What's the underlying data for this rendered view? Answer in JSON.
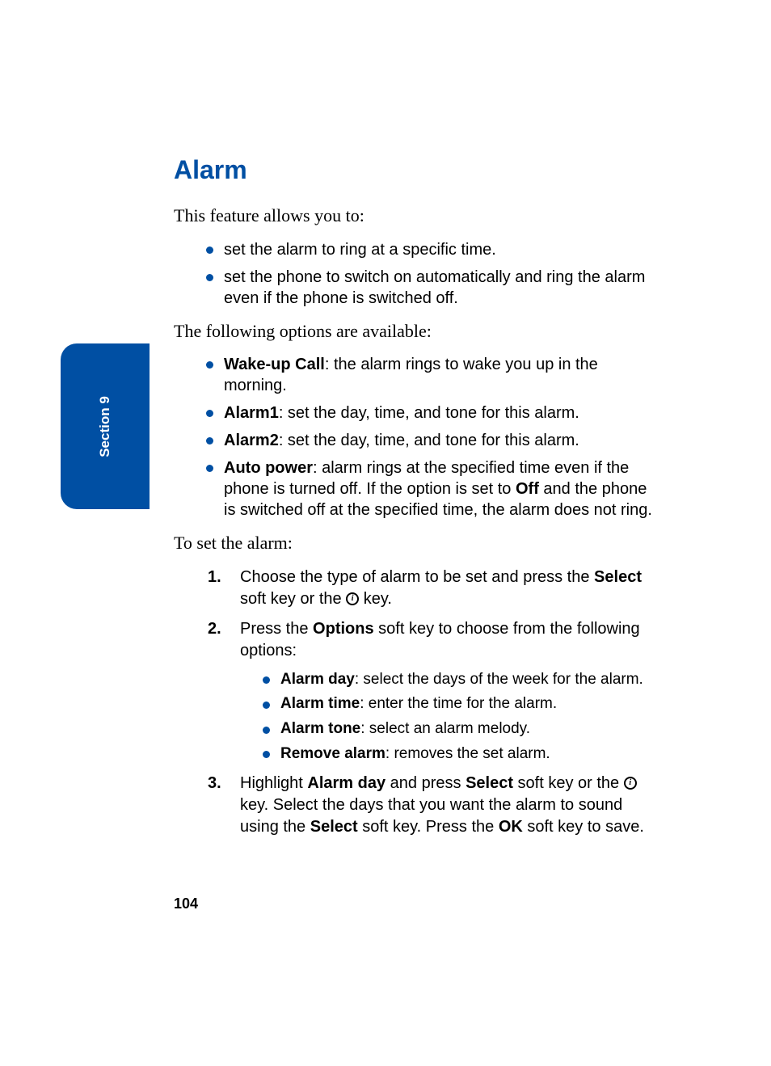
{
  "colors": {
    "accent": "#004fa3"
  },
  "side_tab": {
    "label": "Section 9"
  },
  "title": "Alarm",
  "intro": "This feature allows you to:",
  "intro_bullets": [
    "set the alarm to ring at a specific time.",
    "set the phone to switch on automatically and ring the alarm even if the phone is switched off."
  ],
  "options_lead": "The following options are available:",
  "options": [
    {
      "term": "Wake-up Call",
      "desc": ": the alarm rings to wake you up in the morning."
    },
    {
      "term": "Alarm1",
      "desc": ": set the day, time, and tone for this alarm."
    },
    {
      "term": "Alarm2",
      "desc": ": set the day, time, and tone for this alarm."
    },
    {
      "term": "Auto power",
      "desc_pre": ": alarm rings at the specified time even if the phone is turned off. If the option is set to ",
      "bold_mid": "Off",
      "desc_post": " and the phone is switched off at the specified time, the alarm does not ring."
    }
  ],
  "set_lead": "To set the alarm:",
  "steps": {
    "s1": {
      "num": "1.",
      "t1": "Choose the type of alarm to be set and press the ",
      "b1": "Select",
      "t2": " soft key or the ",
      "t3": " key."
    },
    "s2": {
      "num": "2.",
      "t1": "Press the ",
      "b1": "Options",
      "t2": " soft key to choose from the following options:",
      "subs": [
        {
          "term": "Alarm day",
          "desc": ": select the days of the week for the alarm."
        },
        {
          "term": "Alarm time",
          "desc": ": enter the time for the alarm."
        },
        {
          "term": "Alarm tone",
          "desc": ": select an alarm melody."
        },
        {
          "term": "Remove alarm",
          "desc": ": removes the set alarm."
        }
      ]
    },
    "s3": {
      "num": "3.",
      "t1": "Highlight ",
      "b1": "Alarm day",
      "t2": " and press ",
      "b2": "Select",
      "t3": " soft key or the ",
      "t4": " key. Select the days that you want the alarm to sound using the ",
      "b3": "Select",
      "t5": " soft key. Press the ",
      "b4": "OK",
      "t6": " soft key to save."
    }
  },
  "page_number": "104"
}
